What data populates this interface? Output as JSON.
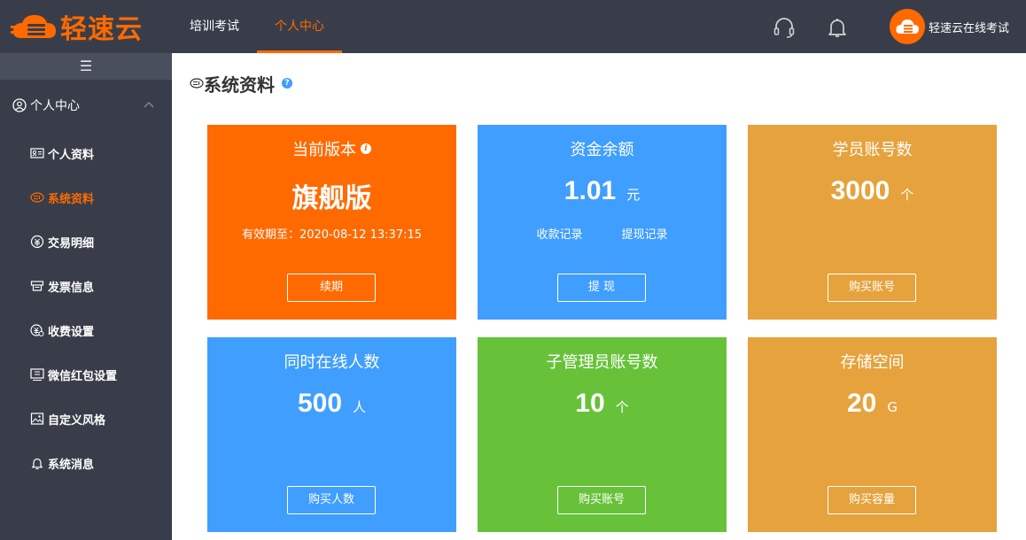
{
  "brand": {
    "name": "轻速云",
    "color": "#ff6a00"
  },
  "nav": [
    {
      "label": "培训考试",
      "active": false
    },
    {
      "label": "个人中心",
      "active": true
    }
  ],
  "header_icons": [
    "headset-icon",
    "bell-icon"
  ],
  "user": {
    "name": "轻速云在线考试"
  },
  "sidebar": {
    "toggle_icon": "☰",
    "group": {
      "label": "个人中心",
      "expanded": true
    },
    "items": [
      {
        "label": "个人资料",
        "icon": "id-card-icon",
        "active": false
      },
      {
        "label": "系统资料",
        "icon": "system-info-icon",
        "active": true
      },
      {
        "label": "交易明细",
        "icon": "transaction-icon",
        "active": false
      },
      {
        "label": "发票信息",
        "icon": "invoice-icon",
        "active": false
      },
      {
        "label": "收费设置",
        "icon": "fee-icon",
        "active": false
      },
      {
        "label": "微信红包设置",
        "icon": "red-packet-icon",
        "active": false
      },
      {
        "label": "自定义风格",
        "icon": "image-icon",
        "active": false
      },
      {
        "label": "系统消息",
        "icon": "bell-icon",
        "active": false
      }
    ]
  },
  "page": {
    "title": "系统资料",
    "help": "?"
  },
  "cards": {
    "version": {
      "title": "当前版本",
      "info": "i",
      "value": "旗舰版",
      "expiry": "有效期至：2020-08-12 13:37:15",
      "button": "续期",
      "color": "#ff6a00"
    },
    "balance": {
      "title": "资金余额",
      "value": "1.01",
      "unit": "元",
      "link1": "收款记录",
      "link2": "提现记录",
      "button": "提 现",
      "color": "#409eff"
    },
    "students": {
      "title": "学员账号数",
      "value": "3000",
      "unit": "个",
      "button": "购买账号",
      "color": "#e6a23c"
    },
    "online": {
      "title": "同时在线人数",
      "value": "500",
      "unit": "人",
      "button": "购买人数",
      "color": "#409eff"
    },
    "admins": {
      "title": "子管理员账号数",
      "value": "10",
      "unit": "个",
      "button": "购买账号",
      "color": "#67c23a"
    },
    "storage": {
      "title": "存储空间",
      "value": "20",
      "unit": "G",
      "button": "购买容量",
      "color": "#e6a23c"
    }
  }
}
